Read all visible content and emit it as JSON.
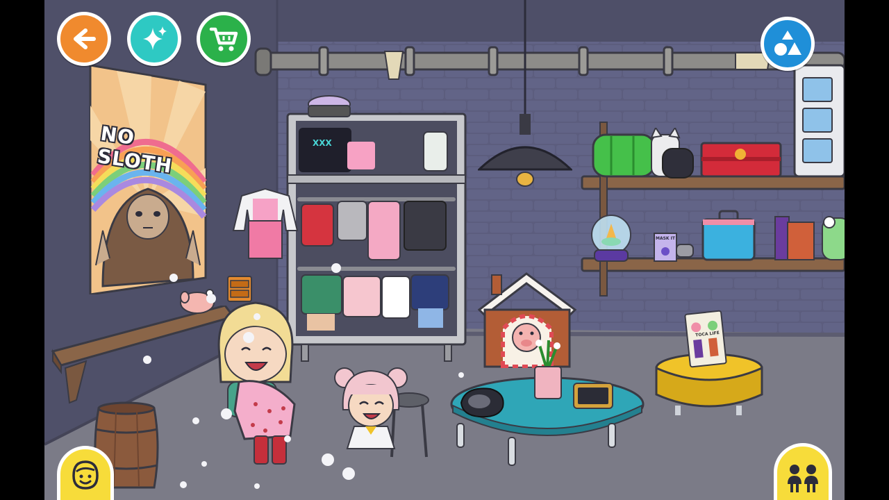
{
  "hud": {
    "back_icon": "arrow-left-icon",
    "magic_icon": "sparkle-icon",
    "shop_icon": "shopping-cart-icon",
    "shapes_icon": "shapes-icon",
    "character_icon": "character-face-icon",
    "people_icon": "two-people-icon",
    "colors": {
      "back": "#f08a2e",
      "magic": "#2ec9c3",
      "shop": "#2bb14a",
      "shapes": "#1f8fd8",
      "yellow": "#f7dc3a"
    }
  },
  "poster": {
    "text": "NO SLOTH"
  },
  "mask_box": {
    "label": "MASK IT"
  },
  "book": {
    "title": "TOCA LIFE"
  }
}
